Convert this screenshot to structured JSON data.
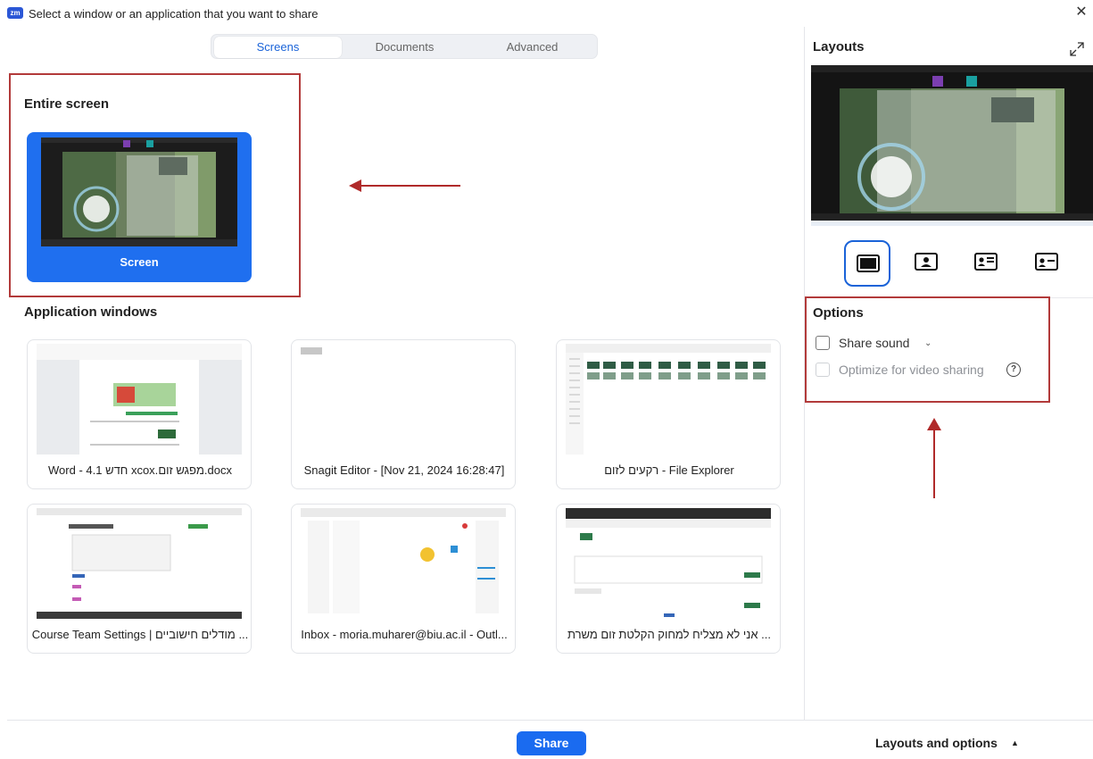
{
  "window": {
    "app_icon_text": "zm",
    "title": "Select a window or an application that you want to share",
    "close_glyph": "✕"
  },
  "tabs": [
    {
      "label": "Screens",
      "active": true
    },
    {
      "label": "Documents",
      "active": false
    },
    {
      "label": "Advanced",
      "active": false
    }
  ],
  "entire_screen": {
    "heading": "Entire screen",
    "card_label": "Screen"
  },
  "application_windows": {
    "heading": "Application windows",
    "items": [
      {
        "label": "Word - 4.1 חדש xcox.מפגש זום.docx"
      },
      {
        "label": "Snagit Editor - [Nov 21, 2024 16:28:47]"
      },
      {
        "label": "רקעים לזום - File Explorer"
      },
      {
        "label": "Course Team Settings | מודלים חישוביים ..."
      },
      {
        "label": "Inbox - moria.muharer@biu.ac.il - Outl..."
      },
      {
        "label": "אני לא מצליח למחוק הקלטת זום משרת ..."
      }
    ]
  },
  "layouts_panel": {
    "heading": "Layouts",
    "expand_icon": "expand-icon",
    "layout_options": [
      {
        "icon": "layout-screen-only-icon",
        "selected": true
      },
      {
        "icon": "layout-picture-in-picture-icon",
        "selected": false
      },
      {
        "icon": "layout-side-by-side-left-icon",
        "selected": false
      },
      {
        "icon": "layout-side-by-side-right-icon",
        "selected": false
      }
    ]
  },
  "options_panel": {
    "heading": "Options",
    "share_sound": {
      "label": "Share sound",
      "checked": false
    },
    "optimize_video": {
      "label": "Optimize for video sharing",
      "checked": false,
      "disabled": true
    },
    "help_glyph": "?"
  },
  "footer": {
    "share_label": "Share",
    "layouts_and_options_label": "Layouts and options",
    "caret": "▲"
  },
  "colors": {
    "accent": "#1a6bf0",
    "annotation_red": "#b02a2a"
  }
}
